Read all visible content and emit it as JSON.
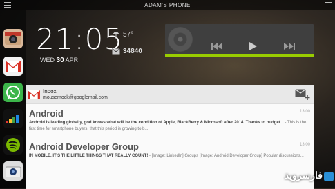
{
  "topbar": {
    "title": "ADAM'S PHONE"
  },
  "dock": {
    "apps": [
      {
        "name": "camera-app"
      },
      {
        "name": "gmail-app"
      },
      {
        "name": "whatsapp-app"
      },
      {
        "name": "deezer-app"
      },
      {
        "name": "spotify-app"
      },
      {
        "name": "camera2-app"
      }
    ]
  },
  "clock": {
    "time": "21:05",
    "date_prefix": "WED",
    "date_day": "30",
    "date_month": "APR"
  },
  "weather": {
    "temperature": "57°",
    "icon": "umbrella-icon"
  },
  "mail_summary": {
    "unread_count": "34840",
    "icon": "envelope-icon"
  },
  "music": {
    "controls": [
      "previous-icon",
      "play-icon",
      "next-icon"
    ],
    "accent": "#99cc00"
  },
  "inbox": {
    "title": "Inbox",
    "account": "mousemock@googlemail.com",
    "messages": [
      {
        "subject": "Android",
        "time": "13:00",
        "snippet_bold": "Android is leading globally, god knows what will be the condition of Apple, BlackBerry & Microsoft after 2014.  Thanks to budget...",
        "snippet_rest": " - This is the first time for smartphone buyers, that this period is growing to b..."
      },
      {
        "subject": "Android Developer Group",
        "time": "13:00",
        "snippet_bold": "IN MOBILE, IT'S THE LITTLE THINGS THAT REALLY COUNT!",
        "snippet_rest": " - [Image: LinkedIn] Groups [Image: Android Developer Group] Popular discussions..."
      }
    ]
  },
  "watermark": {
    "text": "فارسروید"
  }
}
